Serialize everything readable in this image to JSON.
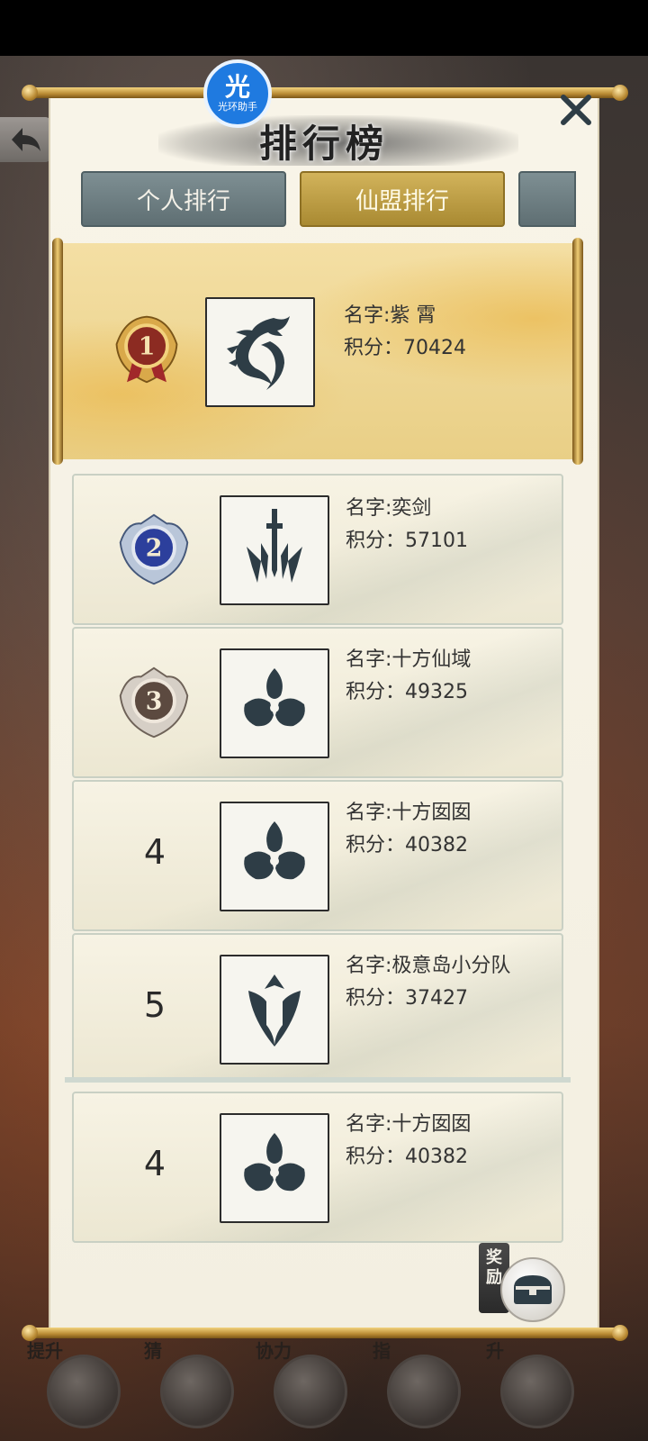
{
  "popup": {
    "title": "排行榜",
    "badge_main": "光",
    "badge_sub": "光环助手"
  },
  "tabs": [
    {
      "label": "个人排行",
      "active": false
    },
    {
      "label": "仙盟排行",
      "active": true
    },
    {
      "label": "",
      "active": false
    }
  ],
  "rankings": [
    {
      "rank_display": "1",
      "name": "名字:紫 霄",
      "score": "积分：70424",
      "emblem": "dragon-icon",
      "medal": "gold"
    },
    {
      "rank_display": "2",
      "name": "名字:奕剑",
      "score": "积分：57101",
      "emblem": "sword-icon",
      "medal": "blue"
    },
    {
      "rank_display": "3",
      "name": "名字:十方仙域",
      "score": "积分：49325",
      "emblem": "trefoil-icon",
      "medal": "bronze"
    },
    {
      "rank_display": "4",
      "name": "名字:十方囡囡",
      "score": "积分：40382",
      "emblem": "trefoil-icon",
      "medal": ""
    },
    {
      "rank_display": "5",
      "name": "名字:极意岛小分队",
      "score": "积分：37427",
      "emblem": "crest-icon",
      "medal": ""
    }
  ],
  "my_rank": {
    "rank_display": "4",
    "name": "名字:十方囡囡",
    "score": "积分：40382",
    "emblem": "trefoil-icon"
  },
  "reward": {
    "label": "奖励"
  },
  "background_labels": [
    "提升",
    "猜",
    "协力",
    "指",
    "升"
  ],
  "colors": {
    "active_tab": "#c4a34a",
    "inactive_tab": "#6f8084",
    "panel": "#f6f2e6"
  }
}
